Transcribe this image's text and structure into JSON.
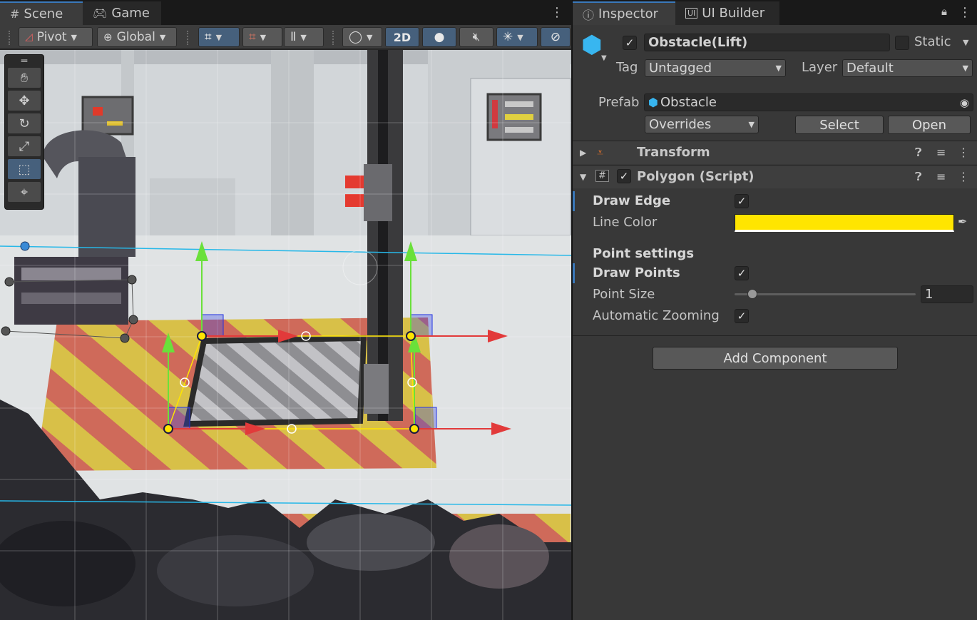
{
  "scene_window": {
    "tabs": [
      {
        "label": "Scene",
        "icon": "grid-icon"
      },
      {
        "label": "Game",
        "icon": "gamepad-icon"
      }
    ],
    "toolbar": {
      "pivot_label": "Pivot",
      "global_label": "Global",
      "mode_2d_label": "2D"
    },
    "tools": [
      "hand-tool",
      "move-tool",
      "rotate-tool",
      "scale-tool",
      "rect-tool",
      "transform-tool"
    ],
    "active_tool": "rect-tool"
  },
  "inspector": {
    "tabs": [
      {
        "label": "Inspector",
        "icon": "info-icon"
      },
      {
        "label": "UI Builder",
        "icon": "ui-builder-icon"
      }
    ],
    "object": {
      "active": true,
      "name": "Obstacle(Lift)",
      "static_label": "Static",
      "tag_label": "Tag",
      "tag_value": "Untagged",
      "layer_label": "Layer",
      "layer_value": "Default"
    },
    "prefab": {
      "label": "Prefab",
      "value": "Obstacle",
      "overrides_label": "Overrides",
      "select_label": "Select",
      "open_label": "Open"
    },
    "components": [
      {
        "name": "Transform",
        "expanded": false
      },
      {
        "name": "Polygon (Script)",
        "expanded": true,
        "enabled": true
      }
    ],
    "polygon": {
      "draw_edge_label": "Draw Edge",
      "draw_edge": true,
      "line_color_label": "Line Color",
      "line_color": "#FFE500",
      "point_settings_label": "Point settings",
      "draw_points_label": "Draw Points",
      "draw_points": true,
      "point_size_label": "Point Size",
      "point_size": "1",
      "point_size_fraction": 0.1,
      "auto_zoom_label": "Automatic Zooming",
      "auto_zoom": true
    },
    "add_component_label": "Add Component"
  }
}
